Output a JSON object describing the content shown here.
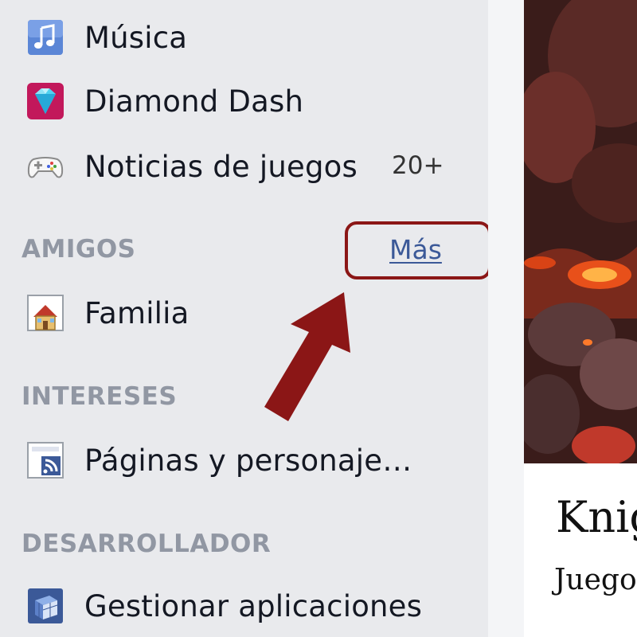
{
  "sidebar": {
    "items_top": [
      {
        "label": "Música",
        "icon": "music-icon"
      },
      {
        "label": "Diamond Dash",
        "icon": "diamond-icon"
      },
      {
        "label": "Noticias de juegos",
        "icon": "gamepad-icon",
        "count": "20+"
      }
    ],
    "friends_section": {
      "title": "AMIGOS",
      "more_link": "Más",
      "items": [
        {
          "label": "Familia",
          "icon": "house-icon"
        }
      ]
    },
    "interests_section": {
      "title": "INTERESES",
      "items": [
        {
          "label": "Páginas y personaje…",
          "icon": "rss-page-icon"
        }
      ]
    },
    "developer_section": {
      "title": "DESARROLLADOR",
      "items": [
        {
          "label": "Gestionar aplicaciones",
          "icon": "cube-icon"
        }
      ]
    }
  },
  "annotation": {
    "highlight_color": "#8b1616"
  },
  "content": {
    "game_title": "Knig",
    "game_subtitle": "Juego"
  }
}
